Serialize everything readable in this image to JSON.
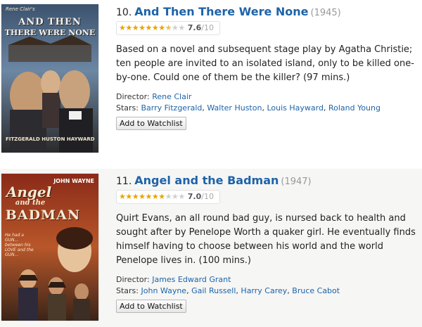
{
  "movies": [
    {
      "index": "10.",
      "title": "And Then There Were None",
      "year": "(1945)",
      "rating": {
        "value": "7.6",
        "max": "/10",
        "stars_filled": 7.6,
        "stars_total": 10
      },
      "description": "Based on a novel and subsequent stage play by Agatha Christie; ten people are invited to an isolated island, only to be killed one-by-one. Could one of them be the killer? (97 mins.)",
      "director_label": "Director:",
      "directors": [
        "Rene Clair"
      ],
      "stars_label": "Stars:",
      "stars": [
        "Barry Fitzgerald",
        "Walter Huston",
        "Louis Hayward",
        "Roland Young"
      ],
      "watchlist_label": "Add to Watchlist",
      "poster": {
        "top_credit": "Rene Clair's",
        "title_line1": "AND THEN",
        "title_line2": "THERE WERE NONE",
        "bottom_names": "FITZGERALD  HUSTON  HAYWARD"
      }
    },
    {
      "index": "11.",
      "title": "Angel and the Badman",
      "year": "(1947)",
      "rating": {
        "value": "7.0",
        "max": "/10",
        "stars_filled": 7.0,
        "stars_total": 10
      },
      "description": "Quirt Evans, an all round bad guy, is nursed back to health and sought after by Penelope Worth a quaker girl. He eventually finds himself having to choose between his world and the world Penelope lives in. (100 mins.)",
      "director_label": "Director:",
      "directors": [
        "James Edward Grant"
      ],
      "stars_label": "Stars:",
      "stars": [
        "John Wayne",
        "Gail Russell",
        "Harry Carey",
        "Bruce Cabot"
      ],
      "watchlist_label": "Add to Watchlist",
      "poster": {
        "top_credit": "JOHN WAYNE",
        "title_line1": "Angel",
        "title_line2": "and the",
        "title_line3": "BADMAN",
        "tagline": "He had a GUN... between his LOVE and the GUN..."
      }
    }
  ],
  "colors": {
    "title_link": "#1d63a8",
    "star_filled": "#e8a400",
    "star_empty": "#cfcfcf",
    "alt_row_bg": "#f6f6f5"
  }
}
